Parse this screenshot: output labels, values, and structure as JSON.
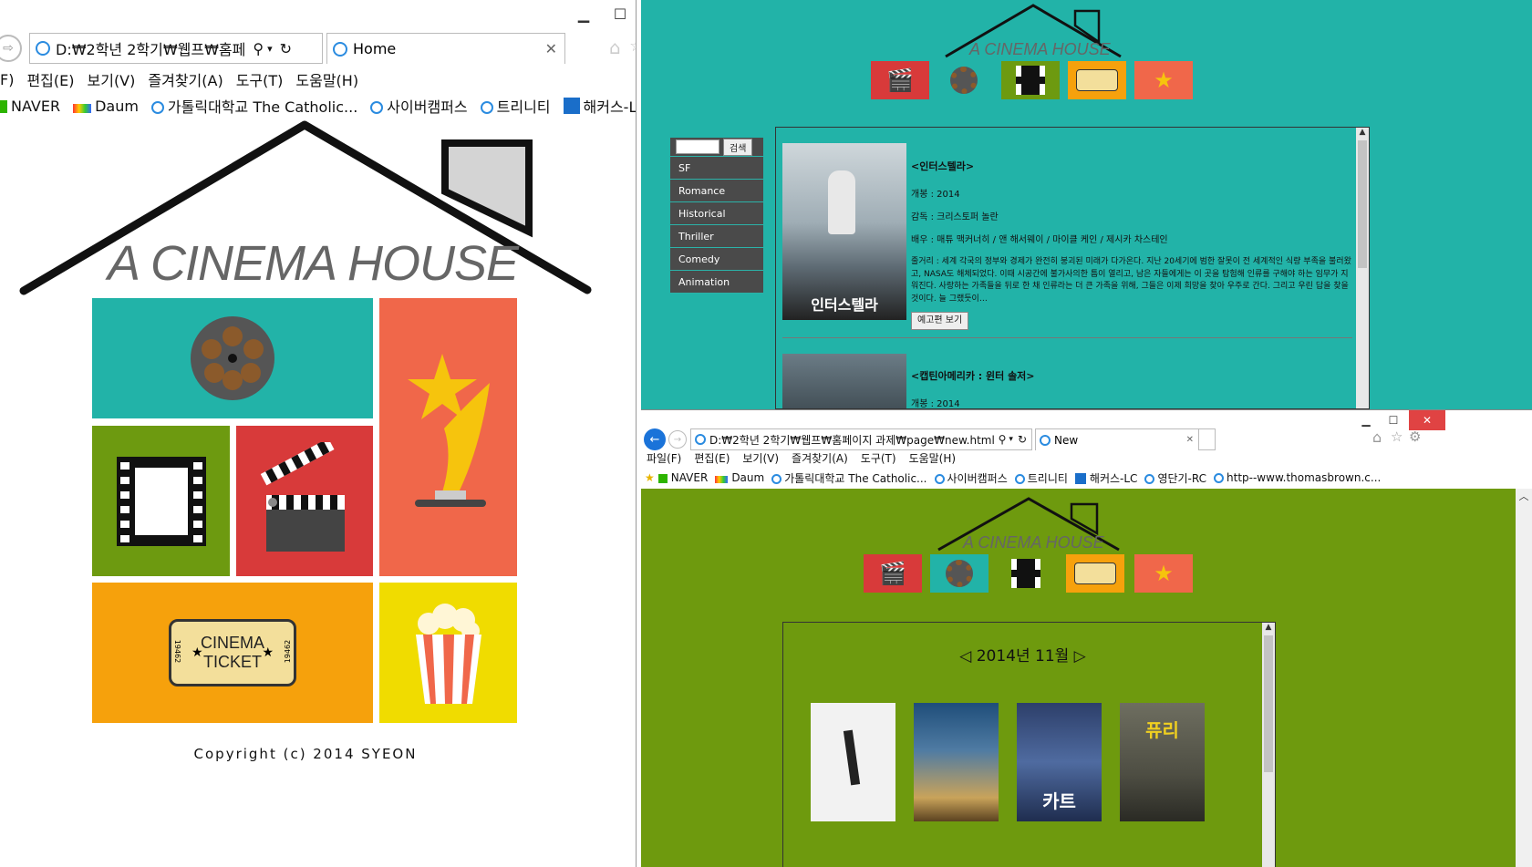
{
  "left_window": {
    "address": "D:₩2학년 2학기₩웹프₩홈페",
    "tab_title": "Home",
    "menu": [
      "F)",
      "편집(E)",
      "보기(V)",
      "즐겨찾기(A)",
      "도구(T)",
      "도움말(H)"
    ],
    "favorites": [
      "NAVER",
      "Daum",
      "가톨릭대학교 The Catholic...",
      "사이버캠퍼스",
      "트리니티",
      "해커스-LC"
    ],
    "logo_text": "A CINEMA HOUSE",
    "ticket_line1": "CINEMA",
    "ticket_line2": "TICKET",
    "ticket_side": "19462",
    "copyright": "Copyright (c) 2014 SYEON"
  },
  "top_right_window": {
    "logo_text": "A CINEMA HOUSE",
    "search_button": "검색",
    "genres": [
      "SF",
      "Romance",
      "Historical",
      "Thriller",
      "Comedy",
      "Animation"
    ],
    "movies": [
      {
        "title": "<인터스텔라>",
        "release": "개봉 : 2014",
        "director": "감독 : 크리스토퍼 놀란",
        "cast": "배우 : 매튜 맥커너히 / 앤 해서웨이 / 마이클 케인 / 제시카 차스테인",
        "synopsis": "줄거리 : 세계 각국의 정부와 경제가 완전히 붕괴된 미래가 다가온다. 지난 20세기에 범한 잘못이 전 세계적인 식량 부족을 불러왔고, NASA도 해체되었다. 이때 시공간에 불가사의한 틈이 열리고, 남은 자들에게는 이 곳을 탐험해 인류를 구해야 하는 임무가 지워진다. 사랑하는 가족들을 뒤로 한 채 인류라는 더 큰 가족을 위해, 그들은 이제 희망을 찾아 우주로 간다. 그리고 우린 답을 찾을 것이다. 늘 그랬듯이…",
        "trailer_button": "예고편 보기",
        "poster_text": "인터스텔라"
      },
      {
        "title": "<캡틴아메리카 : 윈터 솔저>",
        "release": "개봉 : 2014"
      }
    ]
  },
  "bottom_right_window": {
    "address": "D:₩2학년 2학기₩웹프₩홈페이지 과제₩page₩new.html",
    "tab_title": "New",
    "menu": [
      "파일(F)",
      "편집(E)",
      "보기(V)",
      "즐겨찾기(A)",
      "도구(T)",
      "도움말(H)"
    ],
    "favorites": [
      "NAVER",
      "Daum",
      "가톨릭대학교 The Catholic...",
      "사이버캠퍼스",
      "트리니티",
      "해커스-LC",
      "영단기-RC",
      "http--www.thomasbrown.c..."
    ],
    "logo_text": "A CINEMA HOUSE",
    "month_title": "◁ 2014년 11월 ▷",
    "poster_texts": [
      "",
      "",
      "카트",
      "퓨리"
    ]
  },
  "colors": {
    "teal": "#22b3a8",
    "olive": "#6e9a0e",
    "red": "#d83a3a",
    "orange": "#f0674a",
    "amber": "#f6a10c",
    "yellow": "#f0dc00",
    "green_tile": "#6d9a10"
  }
}
